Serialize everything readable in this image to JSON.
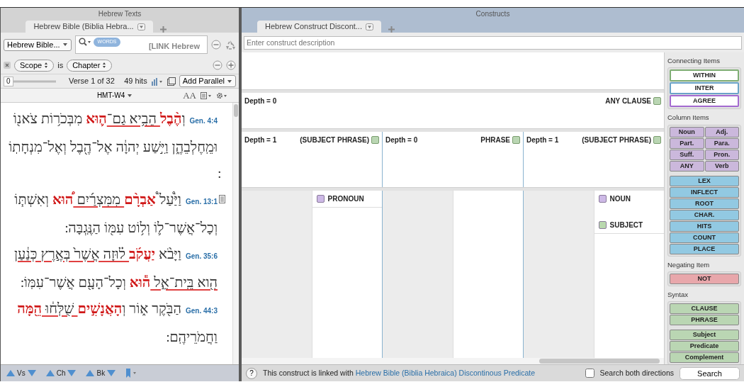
{
  "left_panel": {
    "title": "Hebrew Texts",
    "tabs": [
      {
        "label": "Hebrew Bible (Biblia Hebra...",
        "selected": true
      }
    ],
    "text_selector": "Hebrew Bible...",
    "search": {
      "badge": "WORDS",
      "value": "[LINK Hebrew"
    },
    "scope": {
      "field": "Scope",
      "operator": "is",
      "value": "Chapter"
    },
    "slider_value": "0",
    "verse_position": "Verse 1 of 32",
    "hits": "49 hits",
    "parallel_button": "Add Parallel",
    "text_version": "HMT-W4",
    "font_size_label": "AA",
    "verses": [
      {
        "reference": "Gen. 4:4",
        "note": false,
        "segments": [
          {
            "text": "וְ",
            "kind": "plain"
          },
          {
            "text": "הֶ֨בֶל",
            "kind": "hit"
          },
          {
            "text": " הֵבִ֥יא גַם־",
            "kind": "linked"
          },
          {
            "text": "ה֛וּא",
            "kind": "hit"
          },
          {
            "text": " מִבְּכֹר֥וֹת צֹאנ֖וֹ וּמֵֽחֶלְבֵהֶ֑ן וַיִּ֣שַׁע יְהוָ֔ה אֶל־הֶ֖בֶל וְאֶל־מִנְחָתֽוֹ ׃",
            "kind": "plain"
          }
        ]
      },
      {
        "reference": "Gen. 13:1",
        "note": true,
        "segments": [
          {
            "text": "וַיַּ֩עַל֩ ",
            "kind": "plain"
          },
          {
            "text": "אַבְרָ֨ם",
            "kind": "hit"
          },
          {
            "text": " מִמִּצְרַ֜יִם ",
            "kind": "linked"
          },
          {
            "text": "ה֠וּא",
            "kind": "hit"
          },
          {
            "text": " וְאִשְׁתּ֧וֹ וְכָל־אֲשֶׁר־ל֛וֹ וְל֥וֹט עִמּ֖וֹ הַנֶּֽגְבָּה ׃",
            "kind": "plain"
          }
        ]
      },
      {
        "reference": "Gen. 35:6",
        "note": false,
        "segments": [
          {
            "text": "וַיָּבֹ֨א ",
            "kind": "plain"
          },
          {
            "text": "יַעֲקֹ֜ב",
            "kind": "hit"
          },
          {
            "text": " ל֗וּזָה אֲשֶׁר֙ בְּאֶ֣רֶץ כְּנַ֔עַן הִ֖וא בֵּֽית־אֵ֑ל ",
            "kind": "linked"
          },
          {
            "text": "ה֕וּא",
            "kind": "hit"
          },
          {
            "text": " וְכָל־הָעָ֖ם אֲשֶׁר־עִמּֽוֹ ׃",
            "kind": "plain"
          }
        ]
      },
      {
        "reference": "Gen. 44:3",
        "note": false,
        "segments": [
          {
            "text": "הַבֹּ֖קֶר א֑וֹר וְ",
            "kind": "plain"
          },
          {
            "text": "הָאֲנָשִׁ֣ים",
            "kind": "hit"
          },
          {
            "text": " שֻׁלְּח֔וּ ",
            "kind": "linked"
          },
          {
            "text": "הֵ֖מָּה",
            "kind": "hit"
          },
          {
            "text": " וַחֲמֹרֵיהֶֽם ׃",
            "kind": "plain"
          }
        ]
      }
    ],
    "nav": [
      "Vs",
      "Ch",
      "Bk"
    ]
  },
  "right_panel": {
    "title": "Constructs",
    "tabs": [
      {
        "label": "Hebrew Construct Discont...",
        "selected": true
      }
    ],
    "description_placeholder": "Enter construct description",
    "clause": {
      "depth": "Depth = 0",
      "label": "ANY CLAUSE",
      "checked": false
    },
    "phrases": [
      {
        "depth": "Depth = 1",
        "label": "(SUBJECT PHRASE)",
        "checked": false,
        "words": [
          {
            "label": "PRONOUN",
            "color": "#cdb9e6"
          }
        ]
      },
      {
        "depth": "Depth = 0",
        "label": "PHRASE",
        "checked": false
      },
      {
        "depth": "Depth = 1",
        "label": "(SUBJECT PHRASE)",
        "checked": false,
        "words": [
          {
            "label": "NOUN",
            "color": "#cdb9e6"
          },
          {
            "label": "SUBJECT",
            "color": "#b9d8ae"
          }
        ]
      }
    ],
    "status": {
      "help_label": "?",
      "prefix": "This construct is linked with",
      "link": "Hebrew Bible (Biblia Hebraica) Discontinous Predicate",
      "both_directions": {
        "label": "Search both directions",
        "checked": false
      },
      "search_button": "Search"
    }
  },
  "palette": [
    {
      "title": "Connecting Items",
      "kind": "outline",
      "groups": [
        {
          "kind": "stack",
          "buttons": [
            {
              "label": "WITHIN",
              "color": "#7fae74"
            },
            {
              "label": "INTER",
              "color": "#6aa3c8"
            },
            {
              "label": "AGREE",
              "color": "#a36ad0"
            }
          ]
        }
      ]
    },
    {
      "title": "Column Items",
      "kind": "filled",
      "groups": [
        {
          "kind": "grid",
          "color": "#cbb8dc",
          "buttons": [
            {
              "label": "Noun"
            },
            {
              "label": "Adj."
            },
            {
              "label": "Part."
            },
            {
              "label": "Para."
            },
            {
              "label": "Suff."
            },
            {
              "label": "Pron."
            },
            {
              "label": "ANY"
            },
            {
              "label": "Verb"
            }
          ]
        },
        {
          "kind": "stack",
          "color": "#92c9e2",
          "buttons": [
            {
              "label": "LEX"
            },
            {
              "label": "INFLECT"
            },
            {
              "label": "ROOT"
            },
            {
              "label": "CHAR."
            },
            {
              "label": "HITS"
            },
            {
              "label": "COUNT"
            },
            {
              "label": "PLACE"
            }
          ]
        }
      ]
    },
    {
      "title": "Negating Item",
      "kind": "filled",
      "groups": [
        {
          "kind": "stack",
          "color": "#e8a7ab",
          "buttons": [
            {
              "label": "NOT"
            }
          ]
        }
      ]
    },
    {
      "title": "Syntax",
      "kind": "filled",
      "groups": [
        {
          "kind": "stack",
          "color": "#bad6b3",
          "buttons": [
            {
              "label": "CLAUSE"
            },
            {
              "label": "PHRASE"
            }
          ]
        },
        {
          "kind": "stack",
          "color": "#bad6b3",
          "buttons": [
            {
              "label": "Subject"
            },
            {
              "label": "Predicate"
            },
            {
              "label": "Complement"
            }
          ]
        }
      ]
    }
  ]
}
